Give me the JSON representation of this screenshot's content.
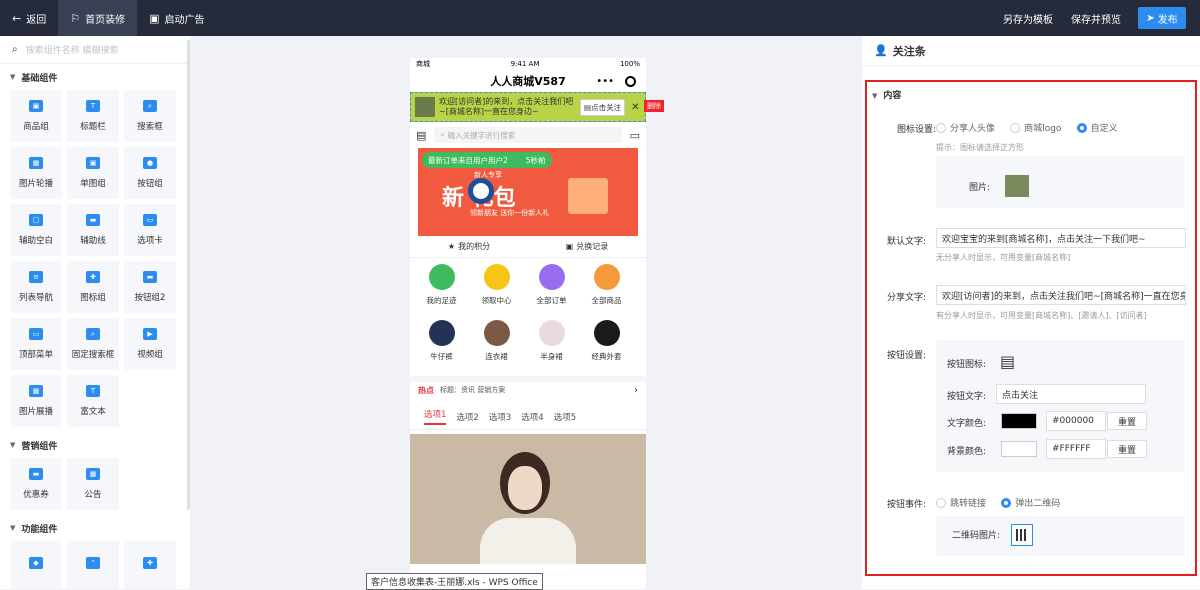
{
  "topbar": {
    "back": "返回",
    "tab_home": "首页装修",
    "tab_ad": "启动广告",
    "save_template": "另存为模板",
    "save_preview": "保存并预览",
    "publish": "发布"
  },
  "left": {
    "search_placeholder": "搜索组件名称 模糊搜索",
    "groups": [
      {
        "title": "基础组件",
        "items": [
          "商品组",
          "标题栏",
          "搜索框",
          "图片轮播",
          "单图组",
          "按钮组",
          "辅助空白",
          "辅助线",
          "选项卡",
          "列表导航",
          "图标组",
          "按钮组2",
          "顶部菜单",
          "固定搜索框",
          "视频组",
          "图片展播",
          "富文本"
        ]
      },
      {
        "title": "营销组件",
        "items": [
          "优惠券",
          "公告"
        ]
      },
      {
        "title": "功能组件",
        "items": [
          "",
          "",
          ""
        ]
      }
    ]
  },
  "phone": {
    "carrier": "商城",
    "time": "9:41 AM",
    "battery": "100%",
    "title": "人人商城V587",
    "follow_text": "欢迎[访问者]的来到，点击关注我们吧~[商城名称]一直在您身边~",
    "follow_btn": "点击关注",
    "delete": "删除",
    "search_placeholder": "输入关键字进行搜索",
    "order_notice": "最新订单来自用户用户2",
    "order_time": "5秒前",
    "banner_big": "新   礼包",
    "banner_small": "新人专享",
    "banner_sub": "领新朋友 送你一份新人礼",
    "points": "我的积分",
    "exchange": "兑换记录",
    "icons": [
      {
        "label": "我的足迹",
        "color": "#3dbb5e"
      },
      {
        "label": "领取中心",
        "color": "#f5c518"
      },
      {
        "label": "全部订单",
        "color": "#9b6cf0"
      },
      {
        "label": "全部商品",
        "color": "#f59a3a"
      },
      {
        "label": "牛仔裤",
        "color": "#223355"
      },
      {
        "label": "连衣裙",
        "color": "#7a5a44"
      },
      {
        "label": "半身裙",
        "color": "#e8d8e0"
      },
      {
        "label": "经典外套",
        "color": "#1a1a1a"
      }
    ],
    "hot_label": "热点",
    "hot_text": "标题：资讯 营销方案",
    "tabs": [
      "选项1",
      "选项2",
      "选项3",
      "选项4",
      "选项5"
    ]
  },
  "tooltip": "客户信息收集表-王丽娜.xls - WPS Office",
  "right": {
    "title": "关注条",
    "section": "内容",
    "icon_setting_label": "图标设置:",
    "icon_options": [
      "分享人头像",
      "商城logo",
      "自定义"
    ],
    "icon_hint": "提示：图标请选择正方形",
    "image_label": "图片:",
    "default_text_label": "默认文字:",
    "default_text_value": "欢迎宝宝的来到[商城名称]，点击关注一下我们吧~",
    "default_text_hint": "无分享人时显示，可用变量[商城名称]",
    "share_text_label": "分享文字:",
    "share_text_value": "欢迎[访问者]的来到，点击关注我们吧~[商城名称]一直在您身边",
    "share_text_hint": "有分享人时显示，可用变量[商城名称]、[邀请人]、[访问者]",
    "button_setting_label": "按钮设置:",
    "button_icon_label": "按钮图标:",
    "button_text_label": "按钮文字:",
    "button_text_value": "点击关注",
    "text_color_label": "文字颜色:",
    "text_color_value": "#000000",
    "bg_color_label": "背景颜色:",
    "bg_color_value": "#FFFFFF",
    "reset": "重置",
    "button_event_label": "按钮事件:",
    "event_options": [
      "跳转链接",
      "弹出二维码"
    ],
    "qr_label": "二维码图片:"
  }
}
